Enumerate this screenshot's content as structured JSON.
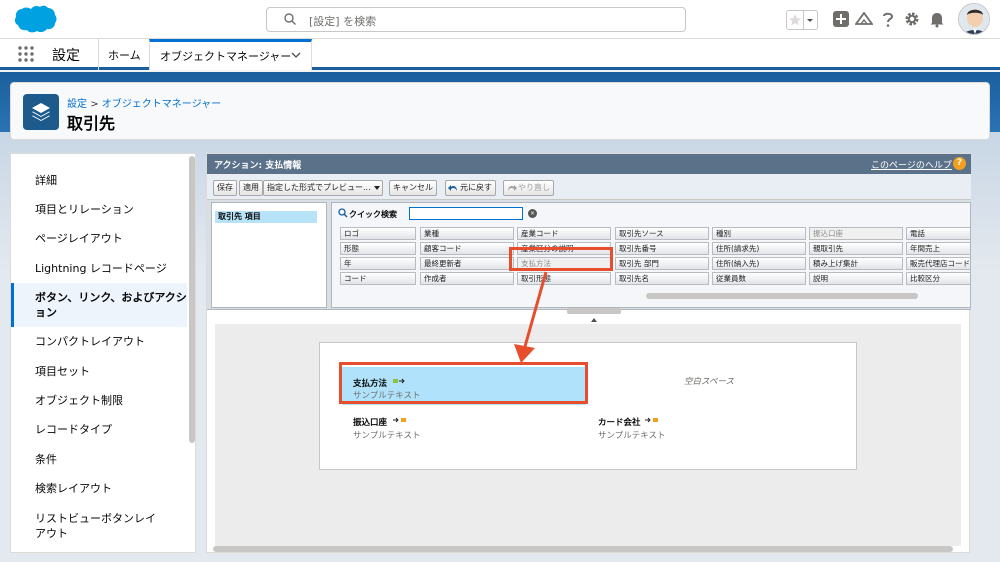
{
  "header": {
    "search_placeholder": "[設定] を検索"
  },
  "nav": {
    "app_name": "設定",
    "home_tab": "ホーム",
    "active_tab": "オブジェクトマネージャー"
  },
  "page_header": {
    "breadcrumb_setup": "設定",
    "breadcrumb_sep": ">",
    "breadcrumb_obj": "オブジェクトマネージャー",
    "title": "取引先"
  },
  "sidebar": {
    "items": [
      {
        "label": "詳細"
      },
      {
        "label": "項目とリレーション"
      },
      {
        "label": "ページレイアウト"
      },
      {
        "label": "Lightning レコードページ"
      },
      {
        "label": "ボタン、リンク、およびアクション"
      },
      {
        "label": "コンパクトレイアウト"
      },
      {
        "label": "項目セット"
      },
      {
        "label": "オブジェクト制限"
      },
      {
        "label": "レコードタイプ"
      },
      {
        "label": "条件"
      },
      {
        "label": "検索レイアウト"
      },
      {
        "label": "リストビューボタンレイアウト"
      }
    ],
    "active_index": 4
  },
  "layout_editor": {
    "title": "アクション: 支払情報",
    "help_link": "このページのヘルプ",
    "help_icon": "?",
    "toolbar": {
      "save": "保存",
      "apply": "適用",
      "preview": "指定した形式でプレビュー...",
      "cancel": "キャンセル",
      "undo": "元に戻す",
      "redo": "やり直し"
    },
    "palette_category": "取引先 項目",
    "quick_search_label": "クイック検索",
    "fields_row1": [
      "ロゴ",
      "業種",
      "産業コード",
      "取引先ソース",
      "種別",
      "振込口座",
      "電話"
    ],
    "fields_row2": [
      "形態",
      "顧客コード",
      "産業区分の説明",
      "取引先番号",
      "住所(請求先)",
      "親取引先",
      "年間売上"
    ],
    "fields_row3": [
      "年",
      "最終更新者",
      "支払方法",
      "取引先 部門",
      "住所(納入先)",
      "積み上げ集計",
      "販売代理店コード"
    ],
    "fields_row4": [
      "コード",
      "作成者",
      "取引形態",
      "取引先名",
      "従業員数",
      "説明",
      "比較区分"
    ],
    "canvas": {
      "selected_field_label": "支払方法",
      "selected_field_sample": "サンプルテキスト",
      "blank_space": "空白スペース",
      "field2_label": "振込口座",
      "field2_sample": "サンプルテキスト",
      "field3_label": "カード会社",
      "field3_sample": "サンプルテキスト"
    }
  },
  "colors": {
    "brand_blue": "#0070d2",
    "header_blue": "#1b5f9e",
    "highlight_red": "#e64e2e",
    "selected_field": "#b0e3fb"
  }
}
